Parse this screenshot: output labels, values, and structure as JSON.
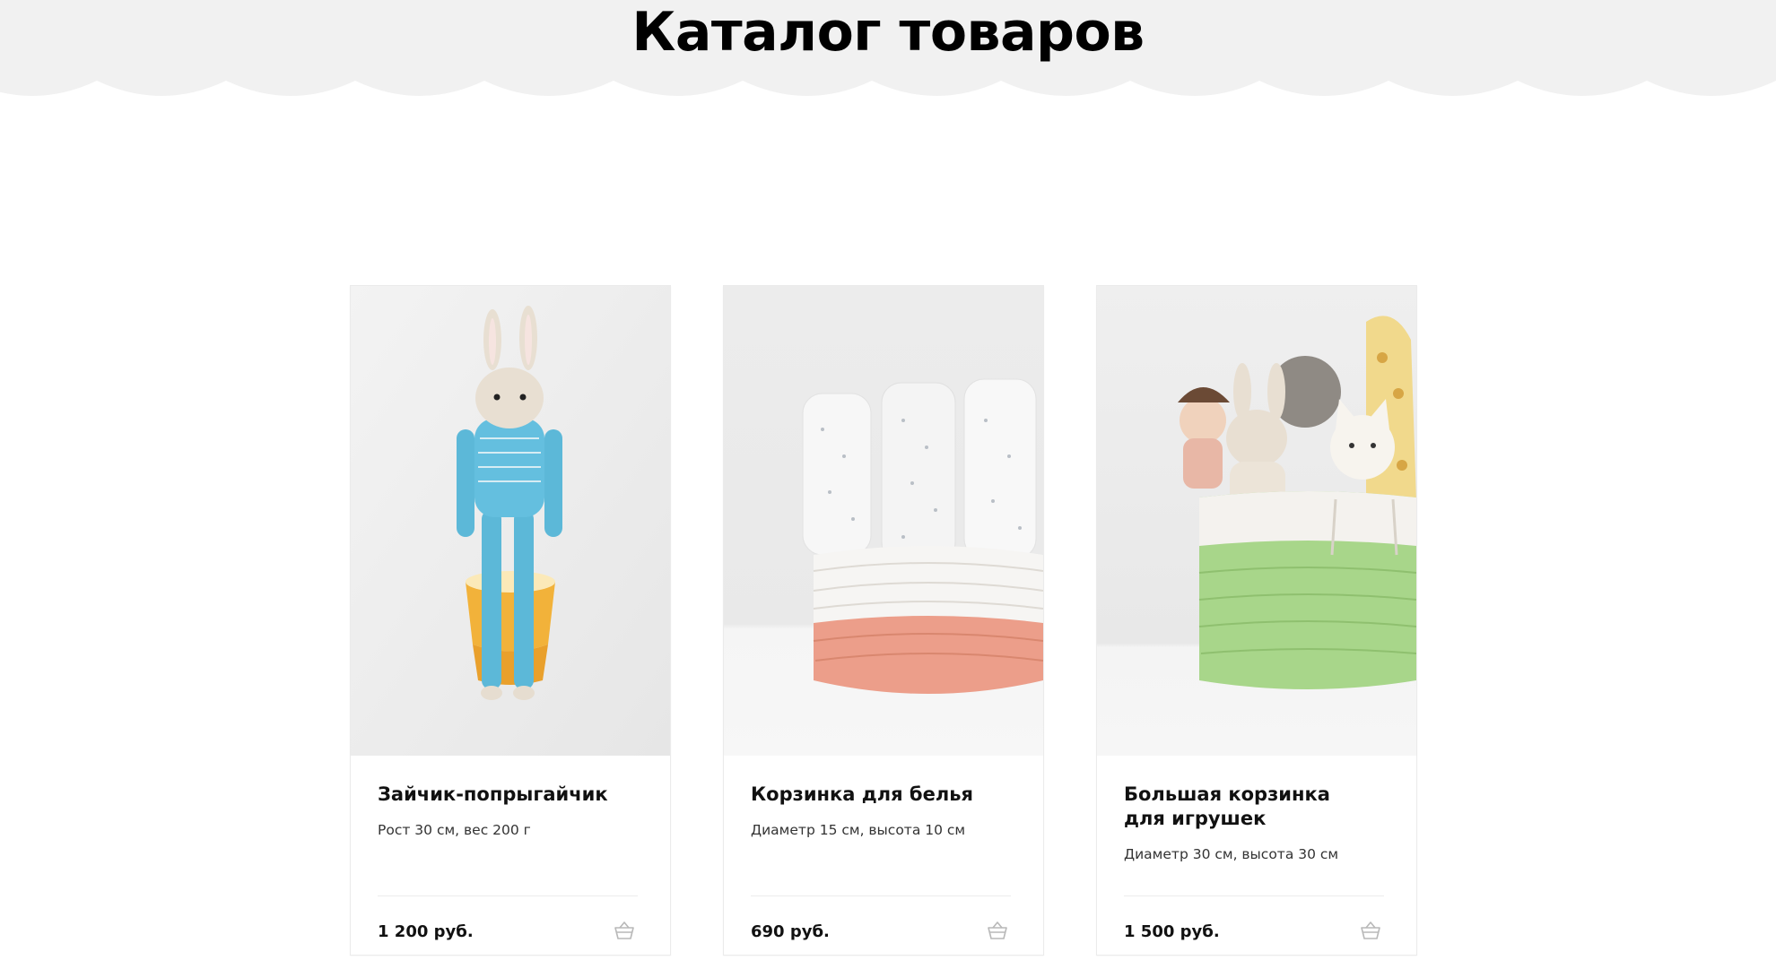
{
  "page": {
    "title": "Каталог товаров"
  },
  "colors": {
    "hero_background": "#f1f1f1",
    "card_border": "#ebebeb",
    "text": "#111111",
    "muted_text": "#333333",
    "icon": "#b8b8b8"
  },
  "products": [
    {
      "title": "Зайчик-попрыгайчик",
      "description": "Рост 30 см, вес 200 г",
      "price": "1 200 руб.",
      "image_icon": "crochet-bunny-image",
      "cart_icon": "basket-icon"
    },
    {
      "title": "Корзинка для белья",
      "description": "Диаметр 15 см, высота 10 см",
      "price": "690 руб.",
      "image_icon": "crochet-basket-image",
      "cart_icon": "basket-icon"
    },
    {
      "title": "Большая корзинка для игрушек",
      "description": "Диаметр 30 см, высота 30 см",
      "price": "1 500 руб.",
      "image_icon": "toy-basket-image",
      "cart_icon": "basket-icon"
    }
  ]
}
